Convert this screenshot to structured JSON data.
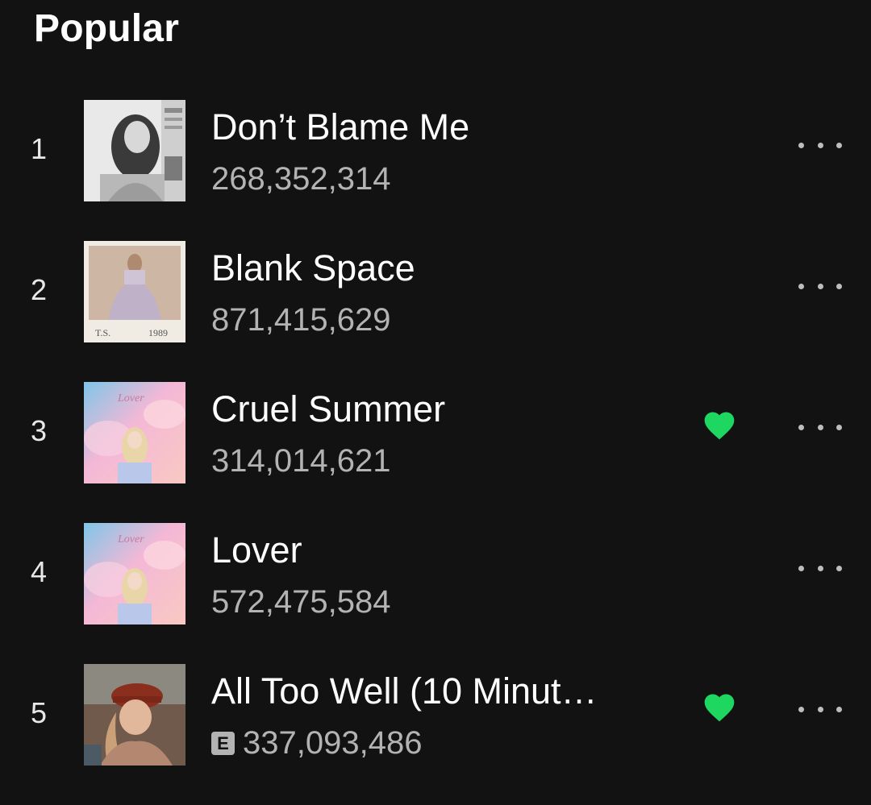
{
  "section": {
    "title": "Popular"
  },
  "tracks": [
    {
      "rank": "1",
      "title": "Don’t Blame Me",
      "plays": "268,352,314",
      "explicit": false,
      "liked": false,
      "cover": "reputation"
    },
    {
      "rank": "2",
      "title": "Blank Space",
      "plays": "871,415,629",
      "explicit": false,
      "liked": false,
      "cover": "1989"
    },
    {
      "rank": "3",
      "title": "Cruel Summer",
      "plays": "314,014,621",
      "explicit": false,
      "liked": true,
      "cover": "lover"
    },
    {
      "rank": "4",
      "title": "Lover",
      "plays": "572,475,584",
      "explicit": false,
      "liked": false,
      "cover": "lover"
    },
    {
      "rank": "5",
      "title": "All Too Well (10 Minut…",
      "plays": "337,093,486",
      "explicit": true,
      "explicit_label": "E",
      "liked": true,
      "cover": "red"
    }
  ],
  "icons": {
    "like": "heart-icon",
    "more": "more-options-icon"
  },
  "colors": {
    "background": "#121212",
    "accent": "#1ed760",
    "secondary_text": "#b3b3b3"
  }
}
